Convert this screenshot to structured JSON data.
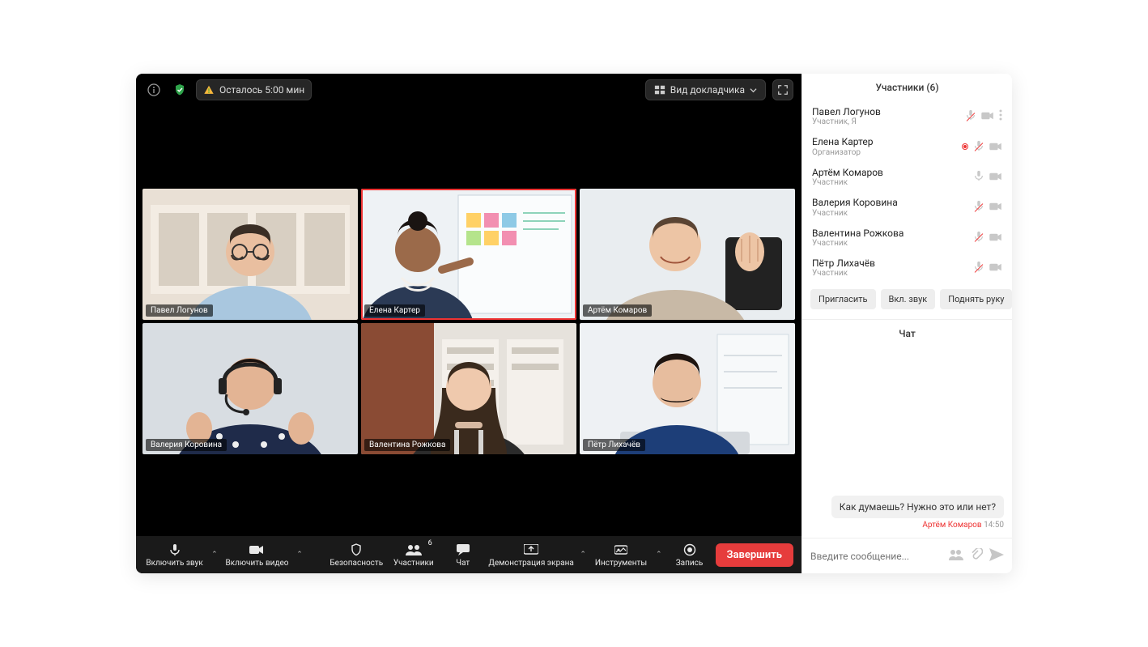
{
  "topbar": {
    "time_remaining": "Осталось 5:00 мин",
    "view_label": "Вид докладчика"
  },
  "tiles": [
    {
      "name": "Павел Логунов",
      "speaking": false
    },
    {
      "name": "Елена Картер",
      "speaking": true
    },
    {
      "name": "Артём Комаров",
      "speaking": false
    },
    {
      "name": "Валерия Коровина",
      "speaking": false
    },
    {
      "name": "Валентина Рожкова",
      "speaking": false
    },
    {
      "name": "Пётр Лихачёв",
      "speaking": false
    }
  ],
  "controls": {
    "audio": "Включить звук",
    "video": "Включить видео",
    "security": "Безопасность",
    "participants": "Участники",
    "participants_count": "6",
    "chat": "Чат",
    "share": "Демонстрация экрана",
    "tools": "Инструменты",
    "record": "Запись",
    "end": "Завершить"
  },
  "side": {
    "participants_title": "Участники (6)",
    "list": [
      {
        "name": "Павел Логунов",
        "role": "Участник, Я",
        "muted": true,
        "cam": true,
        "rec": false,
        "more": true
      },
      {
        "name": "Елена Картер",
        "role": "Организатор",
        "muted": true,
        "cam": true,
        "rec": true,
        "more": false
      },
      {
        "name": "Артём Комаров",
        "role": "Участник",
        "muted": false,
        "cam": true,
        "rec": false,
        "more": false
      },
      {
        "name": "Валерия Коровина",
        "role": "Участник",
        "muted": true,
        "cam": true,
        "rec": false,
        "more": false
      },
      {
        "name": "Валентина Рожкова",
        "role": "Участник",
        "muted": true,
        "cam": true,
        "rec": false,
        "more": false
      },
      {
        "name": "Пётр Лихачёв",
        "role": "Участник",
        "muted": true,
        "cam": true,
        "rec": false,
        "more": false
      }
    ],
    "actions": {
      "invite": "Пригласить",
      "unmute": "Вкл. звук",
      "raise": "Поднять руку"
    },
    "chat_title": "Чат",
    "messages": [
      {
        "text": "Как думаешь? Нужно это или нет?",
        "sender": "Артём Комаров",
        "time": "14:50"
      }
    ],
    "input_placeholder": "Введите сообщение..."
  }
}
